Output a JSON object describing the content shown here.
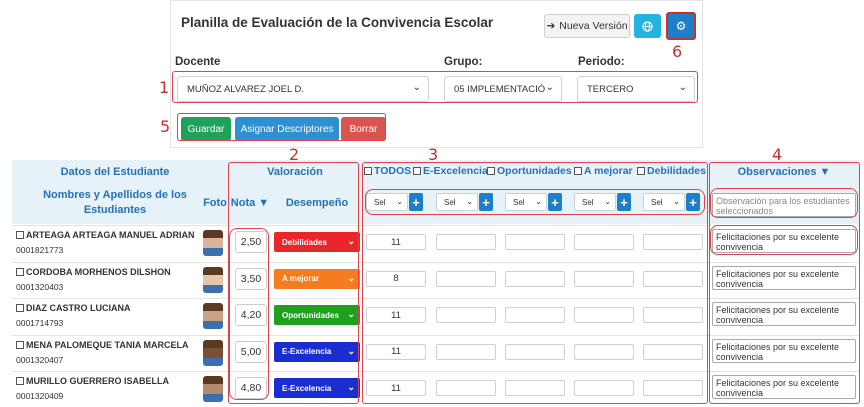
{
  "header": {
    "title": "Planilla de Evaluación de la Convivencia Escolar",
    "nueva_version_label": "Nueva Versión",
    "globe_icon": "globe-icon",
    "gear_icon": "gear-icon"
  },
  "filters": {
    "docente_label": "Docente",
    "docente_value": "MUÑOZ ALVAREZ JOEL D.",
    "grupo_label": "Grupo:",
    "grupo_value": "05 IMPLEMENTACIÓ",
    "periodo_label": "Periodo:",
    "periodo_value": "TERCERO"
  },
  "actions": {
    "guardar": "Guardar",
    "asignar": "Asignar Descriptores",
    "borrar": "Borrar"
  },
  "annotations": [
    "1",
    "2",
    "3",
    "4",
    "5",
    "6"
  ],
  "table": {
    "datos_header": "Datos del Estudiante",
    "nombres_header": "Nombres y Apellidos de los Estudiantes",
    "foto_header": "Foto",
    "valoracion_header": "Valoración",
    "nota_header": "Nota ▼",
    "desempeno_header": "Desempeño",
    "observaciones_header": "Observaciones ▼",
    "observacion_placeholder": "Observación para los estudiantes seleccionados",
    "descriptor_filters": [
      "TODOS",
      "E-Excelencia",
      "Oportunidades",
      "A mejorar",
      "Debilidades"
    ],
    "descriptor_select_label": "Sel",
    "plus_label": "+",
    "rows": [
      {
        "name": "ARTEAGA ARTEAGA MANUEL ADRIAN",
        "id": "0001821773",
        "nota": "2,50",
        "desempeno": "Debilidades",
        "color": "#e8262b",
        "d1": "11",
        "obs": "Felicitaciones por su excelente convivencia"
      },
      {
        "name": "CORDOBA MORHENOS DILSHON",
        "id": "0001320403",
        "nota": "3,50",
        "desempeno": "A mejorar",
        "color": "#f47d20",
        "d1": "8",
        "obs": "Felicitaciones por su excelente convivencia"
      },
      {
        "name": "DIAZ CASTRO LUCIANA",
        "id": "0001714793",
        "nota": "4,20",
        "desempeno": "Oportunidades",
        "color": "#1ea21e",
        "d1": "11",
        "obs": "Felicitaciones por su excelente convivencia"
      },
      {
        "name": "MENA PALOMEQUE TANIA MARCELA",
        "id": "0001320407",
        "nota": "5,00",
        "desempeno": "E-Excelencia",
        "color": "#1a2dd0",
        "d1": "11",
        "obs": "Felicitaciones por su excelente convivencia"
      },
      {
        "name": "MURILLO GUERRERO ISABELLA",
        "id": "0001320409",
        "nota": "4,80",
        "desempeno": "E-Excelencia",
        "color": "#1a2dd0",
        "d1": "11",
        "obs": "Felicitaciones por su excelente convivencia"
      }
    ]
  },
  "colors": {
    "primary": "#1d7fc9",
    "success": "#1ea25a",
    "danger": "#d9534f",
    "header_text": "#2472b6",
    "annotation": "#c9302c"
  }
}
